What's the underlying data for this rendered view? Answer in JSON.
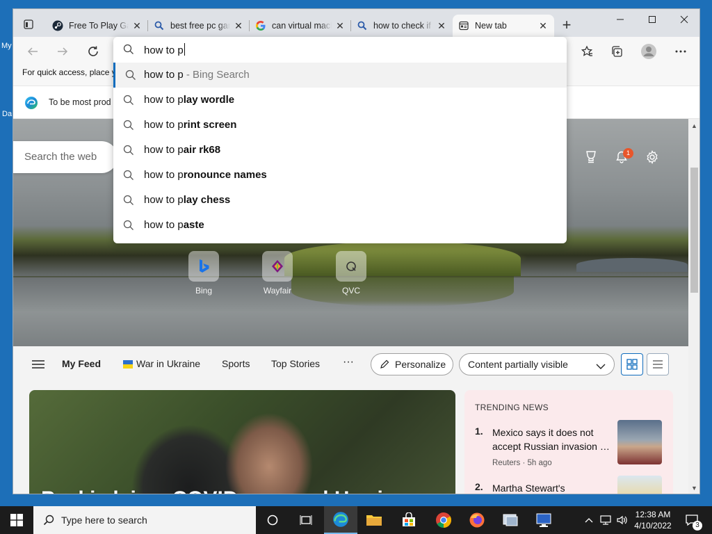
{
  "desktop": {
    "icon_label_1": "My",
    "icon_label_2": "Da"
  },
  "tabs": [
    {
      "title": "Free To Play Games",
      "favicon": "steam-icon"
    },
    {
      "title": "best free pc games",
      "favicon": "search-icon"
    },
    {
      "title": "can virtual machines",
      "favicon": "google-icon"
    },
    {
      "title": "how to check if",
      "favicon": "search-icon"
    },
    {
      "title": "New tab",
      "favicon": "newtab-icon"
    }
  ],
  "favorites_bar": {
    "text": "For quick access, place y"
  },
  "infobar": {
    "message": "To be most prod"
  },
  "address_bar": {
    "value": "how to p"
  },
  "suggestions": [
    {
      "typed": "how to p",
      "rest": "",
      "suffix": " - Bing Search"
    },
    {
      "typed": "how to p",
      "rest": "lay wordle",
      "suffix": ""
    },
    {
      "typed": "how to p",
      "rest": "rint screen",
      "suffix": ""
    },
    {
      "typed": "how to p",
      "rest": "air rk68",
      "suffix": ""
    },
    {
      "typed": "how to p",
      "rest": "ronounce names",
      "suffix": ""
    },
    {
      "typed": "how to p",
      "rest": "lay chess",
      "suffix": ""
    },
    {
      "typed": "how to p",
      "rest": "aste",
      "suffix": ""
    }
  ],
  "newtab": {
    "search_placeholder": "Search the web",
    "notification_count": "1",
    "quick_links": [
      {
        "label": "Bing"
      },
      {
        "label": "Wayfair"
      },
      {
        "label": "QVC"
      }
    ]
  },
  "feed_nav": {
    "my_feed": "My Feed",
    "war_in_ukraine": "War in Ukraine",
    "sports": "Sports",
    "top_stories": "Top Stories",
    "more": "···",
    "personalize": "Personalize",
    "content_visibility": "Content partially visible"
  },
  "top_story": {
    "headline": "Psaki claims COVID exposed Harris were"
  },
  "trending": {
    "title": "TRENDING NEWS",
    "items": [
      {
        "num": "1.",
        "title": "Mexico says it does not accept Russian invasion …",
        "source": "Reuters · 5h ago"
      },
      {
        "num": "2.",
        "title": "Martha Stewart's Heartbreaking",
        "source": ""
      }
    ]
  },
  "taskbar": {
    "search_placeholder": "Type here to search",
    "time": "12:38 AM",
    "date": "4/10/2022",
    "notification_count": "3"
  },
  "colors": {
    "accent": "#0f6cbd",
    "taskbar": "#1c1c1c",
    "desktop": "#1d6fb8",
    "trending_bg": "#fbeaec"
  }
}
